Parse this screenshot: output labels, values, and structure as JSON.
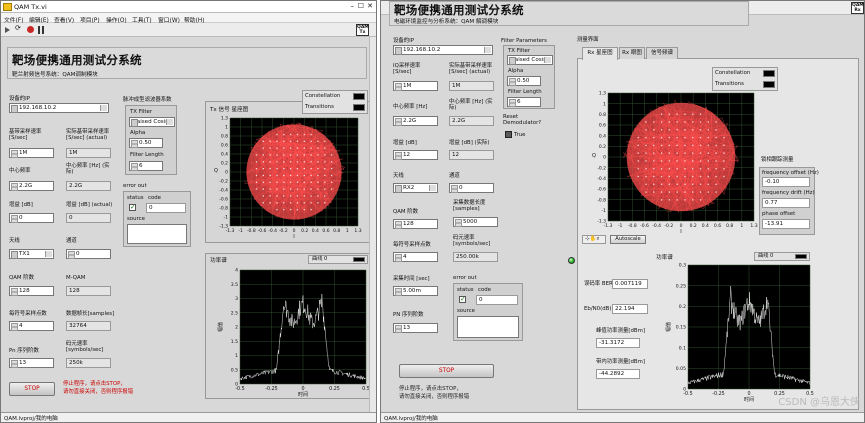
{
  "tx": {
    "title": "QAM Tx.vi",
    "menu": [
      "文件(F)",
      "编辑(E)",
      "查看(V)",
      "项目(P)",
      "操作(O)",
      "工具(T)",
      "窗口(W)",
      "帮助(H)"
    ],
    "icon_text": "QAM Tx",
    "header_title": "靶场便携通用测试分系统",
    "header_subtitle": "靶兰射频信号系统：QAM调制模块",
    "device_ip_label": "设备的IP",
    "device_ip": "192.168.10.2",
    "sym_rate_label": "基带采样速率 [S/sec]",
    "sym_rate": "1M",
    "actual_rate_label": "实际基带采样速率 [S/sec] (actual)",
    "actual_rate": "1M",
    "center_freq_label": "中心频率",
    "center_freq": "2.2G",
    "center_freq_actual_label": "中心频率 [Hz] (实际)",
    "center_freq_actual": "2.2G",
    "gain_label": "增益 [dB]",
    "gain": "0",
    "gain_actual_label": "增益 [dB] (actual)",
    "gain_actual": "0",
    "antenna_label": "天线",
    "antenna": "TX1",
    "channel_label": "通道",
    "channel": "0",
    "qam_order_label": "QAM 阶数",
    "qam_order": "128",
    "m_qam_label": "M-QAM",
    "m_qam": "128",
    "samples_per_symbol_label": "每符号采样点数",
    "samples_per_symbol": "4",
    "data_length_label": "数据帧长[samples]",
    "data_length": "32764",
    "pn_order_label": "Pn 序列阶数",
    "pn_order": "13",
    "symbol_rate_label": "码元速率 [symbols/sec]",
    "symbol_rate": "250k",
    "filter_cluster_label": "脉冲成型滤波器系数",
    "tx_filter_label": "TX Filter",
    "tx_filter": "Raised Cosine",
    "alpha_label": "Alpha",
    "alpha": "0.50",
    "filter_length_label": "Filter Length",
    "filter_length": "6",
    "error_out_label": "error out",
    "status_label": "status",
    "code_label": "code",
    "code": "0",
    "source_label": "source",
    "stop_label": "STOP",
    "stop_hint_1": "停止程序，请点击STOP，",
    "stop_hint_2": "请勿直接关闭，否则程序报错",
    "constellation_title": "Tx 信号 星座图",
    "legend_constellation": "Constellation",
    "legend_transitions": "Transitions",
    "const_x_label": "I",
    "const_y_label": "Q",
    "psd_title": "功率谱",
    "psd_legend": "曲线 0",
    "psd_x_label": "时间",
    "psd_y_label": "幅值",
    "status_path": "QAM.lvproj/我的电脑"
  },
  "rx": {
    "title": "",
    "icon_text": "QAM Rx",
    "header_title": "靶场便携通用测试分系统",
    "header_subtitle": "电磁环境监控与分析系统：QAM 解调模块",
    "device_ip_label": "设备的IP",
    "device_ip": "192.168.10.2",
    "iq_rate_label": "IQ采样速率 [S/sec]",
    "iq_rate": "1M",
    "actual_rate_label": "实际基带采样速率 [S/sec] (actual)",
    "actual_rate": "1M",
    "center_freq_label": "中心频率 [Hz]",
    "center_freq": "2.2G",
    "center_freq_actual_label": "中心频率 [Hz] (实际)",
    "center_freq_actual": "2.2G",
    "gain_label": "增益 [dB]",
    "gain": "12",
    "gain_actual_label": "增益 [dB] (实际)",
    "gain_actual": "12",
    "antenna_label": "天线",
    "antenna": "RX2",
    "channel_label": "通道",
    "channel": "0",
    "qam_order_label": "QAM 阶数",
    "qam_order": "128",
    "samples_label": "采集数据长度 [samples]",
    "samples": "5000",
    "samples_per_symbol_label": "每符号采样点数",
    "samples_per_symbol": "4",
    "symbol_rate_label": "码元速率 [symbols/sec]",
    "symbol_rate": "250.00k",
    "acq_time_label": "采集时间 [sec]",
    "acq_time": "5.00m",
    "pn_order_label": "PN 序列阶数",
    "pn_order": "13",
    "filter_params_label": "Filter Parameters",
    "tx_filter_label": "TX Filter",
    "tx_filter": "Raised Cosine",
    "alpha_label": "Alpha",
    "alpha": "0.50",
    "filter_length_label": "Filter Length",
    "filter_length": "6",
    "reset_label": "Reset Demodulator?",
    "reset_state": "True",
    "error_out_label": "error out",
    "status_label": "status",
    "code_label": "code",
    "code": "0",
    "source_label": "source",
    "stop_label": "STOP",
    "stop_hint_1": "停止程序，请点击STOP，",
    "stop_hint_2": "请勿直接关闭，否则程序报错",
    "measure_tab_group": "测量界面",
    "tabs": [
      "Rx 星座图",
      "Rx 眼图",
      "信号频谱"
    ],
    "legend_constellation": "Constellation",
    "legend_transitions": "Transitions",
    "const_x_label": "I",
    "const_y_label": "Q",
    "autoscale": "Autoscale",
    "sync_cluster_label": "锁相跟踪测量",
    "freq_offset_label": "frequency offset (Hz)",
    "freq_offset": "-0.10",
    "freq_drift_label": "frequency drift (Hz)",
    "freq_drift": "0.77",
    "phase_offset_label": "phase offset",
    "phase_offset": "-13.91",
    "ber_label": "误码率 BER",
    "ber": "0.007119",
    "ebn0_label": "Eb/N0(dB)",
    "ebn0": "22.194",
    "peak_power_label": "峰值功率测量[dBm]",
    "peak_power": "-31.3172",
    "band_power_label": "带内功率测量[dBm]",
    "band_power": "-44.2892",
    "psd_title": "功率谱",
    "psd_legend": "曲线 0",
    "psd_x_label": "时间",
    "psd_y_label": "幅值",
    "status_path": "QAM.lvproj/我的电脑"
  },
  "axes": {
    "const_ticks_y": [
      "1.3",
      "1",
      "0.8",
      "0.6",
      "0.4",
      "0.2",
      "0",
      "-0.2",
      "-0.4",
      "-0.6",
      "-0.8",
      "-1",
      "-1.3"
    ],
    "const_ticks_x": [
      "-1.3",
      "-1",
      "-0.8",
      "-0.6",
      "-0.4",
      "-0.2",
      "0",
      "0.2",
      "0.4",
      "0.6",
      "0.8",
      "1",
      "1.3"
    ],
    "psd_ticks_x": [
      "-0.5",
      "-0.25",
      "0",
      "0.25",
      "0.5"
    ],
    "psd_ticks_y_tx": [
      "4",
      "3.5",
      "3",
      "2.5",
      "2",
      "1.5",
      "1",
      "0.5",
      "0"
    ],
    "psd_ticks_y_rx": [
      "0.3",
      "0.25",
      "0.2",
      "0.15",
      "0.1",
      "0.05",
      "0"
    ]
  },
  "watermark": "CSDN @乌恩大侠",
  "colors": {
    "constellation": "#ff4d4d",
    "psd": "#ffffff",
    "grid": "#2f4f2f",
    "axis_bg": "#000000"
  }
}
